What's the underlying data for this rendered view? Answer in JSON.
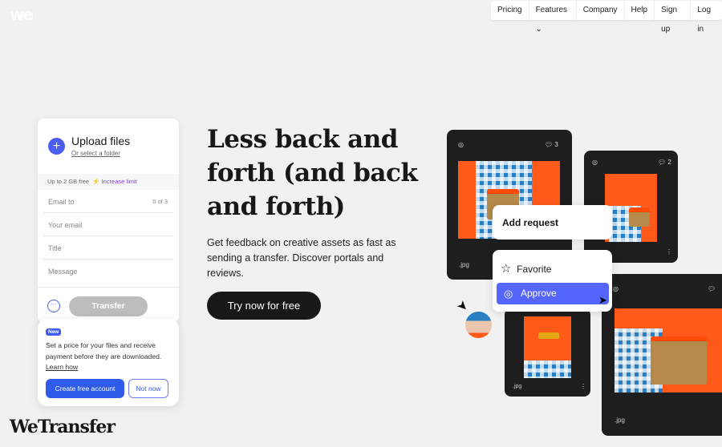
{
  "brand": {
    "logo": "we",
    "wordmark": "WeTransfer"
  },
  "nav": [
    {
      "label": "Pricing"
    },
    {
      "label": "Features ⌄"
    },
    {
      "label": "Company"
    },
    {
      "label": "Help"
    },
    {
      "label": "Sign up"
    },
    {
      "label": "Log in"
    }
  ],
  "upload": {
    "title": "Upload files",
    "select_folder": "Or select a folder",
    "limit": "Up to 2 GB free",
    "increase": "Increase limit",
    "email_to": "Email to",
    "email_count": "0 of 3",
    "your_email": "Your email",
    "title_field": "Title",
    "message": "Message",
    "transfer": "Transfer"
  },
  "promo": {
    "badge": "New",
    "text": "Set a price for your files and receive payment before they are downloaded.",
    "learn": "Learn how",
    "create": "Create free account",
    "not_now": "Not now"
  },
  "hero": {
    "heading": "Less back and forth (and back and forth)",
    "subtext": "Get feedback on creative assets as fast as sending a transfer. Discover portals and reviews.",
    "cta": "Try now for free"
  },
  "cards": [
    {
      "comments": "3",
      "ext": ".jpg"
    },
    {
      "comments": "2",
      "ext": ""
    },
    {
      "ext": ".jpg"
    },
    {
      "comments": "",
      "ext": ".jpg"
    }
  ],
  "menu": {
    "add_request": "Add request",
    "favorite": "Favorite",
    "approve": "Approve"
  },
  "colors": {
    "accent": "#5566ff",
    "cta": "#2f5be8",
    "photo_bg": "#ff5a1a"
  }
}
